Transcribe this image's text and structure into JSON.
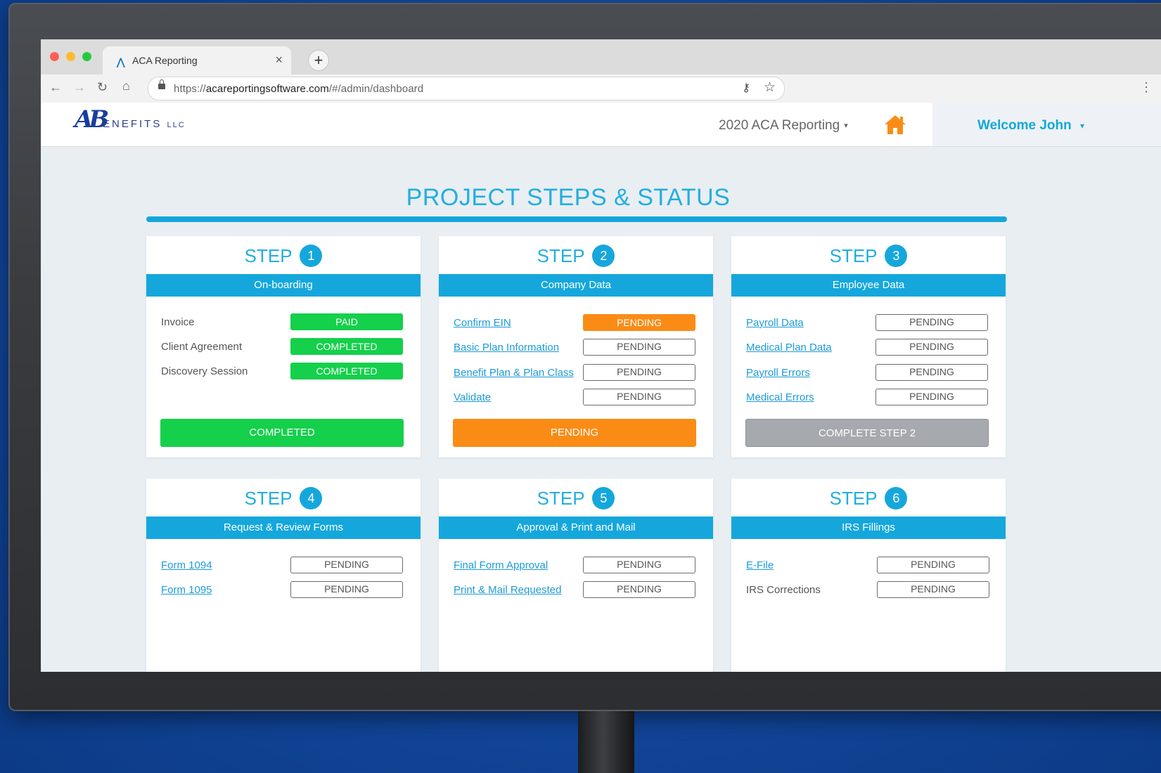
{
  "browser": {
    "tab_title": "ACA Reporting",
    "tab_close": "×",
    "new_tab": "+",
    "url_scheme": "https://",
    "url_host": "acareportingsoftware.com",
    "url_path": "/#/admin/dashboard",
    "icons": [
      "back-icon",
      "forward-icon",
      "reload-icon",
      "home-icon",
      "lock-icon",
      "key-icon",
      "star-icon",
      "menu-icon"
    ]
  },
  "header": {
    "logo_ab": "AB",
    "logo_text": "ENEFITS",
    "logo_llc": "LLC",
    "year_select": "2020 ACA Reporting",
    "caret": "▾",
    "welcome": "Welcome John",
    "home_icon_color": "#fa8c16"
  },
  "page": {
    "title": "PROJECT STEPS & STATUS",
    "step_word": "STEP"
  },
  "colors": {
    "accent": "#15a7dc",
    "completed": "#14d04b",
    "pending_active": "#fa8c16",
    "disabled": "#a6a9ad"
  },
  "steps": [
    {
      "num": "1",
      "title": "On-boarding",
      "rows": [
        {
          "label": "Invoice",
          "status": "PAID"
        },
        {
          "label": "Client Agreement",
          "status": "COMPLETED"
        },
        {
          "label": "Discovery Session",
          "status": "COMPLETED"
        }
      ],
      "action": "COMPLETED"
    },
    {
      "num": "2",
      "title": "Company Data",
      "rows": [
        {
          "label": "Confirm EIN",
          "status": "PENDING"
        },
        {
          "label": "Basic Plan Information",
          "status": "PENDING"
        },
        {
          "label": "Benefit Plan & Plan Class",
          "status": "PENDING"
        },
        {
          "label": "Validate",
          "status": "PENDING"
        }
      ],
      "action": "PENDING"
    },
    {
      "num": "3",
      "title": "Employee Data",
      "rows": [
        {
          "label": "Payroll Data",
          "status": "PENDING"
        },
        {
          "label": "Medical Plan Data",
          "status": "PENDING"
        },
        {
          "label": "Payroll Errors",
          "status": "PENDING"
        },
        {
          "label": "Medical Errors",
          "status": "PENDING"
        }
      ],
      "action": "COMPLETE STEP 2"
    },
    {
      "num": "4",
      "title": "Request & Review Forms",
      "rows": [
        {
          "label": "Form 1094",
          "status": "PENDING"
        },
        {
          "label": "Form 1095",
          "status": "PENDING"
        }
      ]
    },
    {
      "num": "5",
      "title": "Approval & Print and Mail",
      "rows": [
        {
          "label": "Final Form Approval",
          "status": "PENDING"
        },
        {
          "label": "Print & Mail Requested",
          "status": "PENDING"
        }
      ]
    },
    {
      "num": "6",
      "title": "IRS Fillings",
      "rows": [
        {
          "label": "E-File",
          "status": "PENDING"
        },
        {
          "label": "IRS Corrections",
          "status": "PENDING"
        }
      ]
    }
  ]
}
